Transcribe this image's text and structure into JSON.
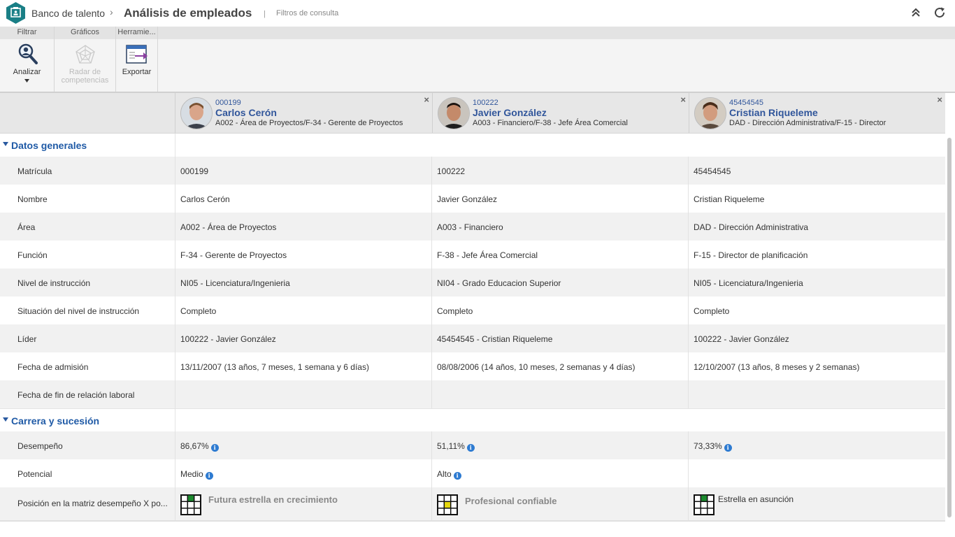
{
  "header": {
    "breadcrumb_root": "Banco de talento",
    "breadcrumb_sep": "›",
    "title": "Análisis de empleados",
    "title_sep": "|",
    "filters_link": "Filtros de consulta",
    "collapse_icon": "double-chevron-up-icon",
    "refresh_icon": "refresh-icon"
  },
  "ribbon": {
    "tabs": [
      "Filtrar",
      "Gráficos",
      "Herramie..."
    ],
    "buttons": {
      "analyze": "Analizar",
      "radar_line1": "Radar de",
      "radar_line2": "competencias",
      "export": "Exportar"
    }
  },
  "employees": [
    {
      "code": "000199",
      "name": "Carlos Cerón",
      "desc": "A002 - Área de Proyectos/F-34 - Gerente de Proyectos"
    },
    {
      "code": "100222",
      "name": "Javier González",
      "desc": "A003 - Financiero/F-38 - Jefe Área Comercial"
    },
    {
      "code": "45454545",
      "name": "Cristian Riqueleme",
      "desc": "DAD - Dirección Administrativa/F-15 - Director"
    }
  ],
  "close_glyph": "×",
  "sections": {
    "general": {
      "title": "Datos generales",
      "rows": [
        {
          "label": "Matrícula",
          "values": [
            "000199",
            "100222",
            "45454545"
          ]
        },
        {
          "label": "Nombre",
          "values": [
            "Carlos Cerón",
            "Javier González",
            "Cristian Riqueleme"
          ]
        },
        {
          "label": "Área",
          "values": [
            "A002 - Área de Proyectos",
            "A003 - Financiero",
            "DAD - Dirección Administrativa"
          ]
        },
        {
          "label": "Función",
          "values": [
            "F-34 - Gerente de Proyectos",
            "F-38 - Jefe Área Comercial",
            "F-15 - Director de planificación"
          ]
        },
        {
          "label": "Nivel de instrucción",
          "values": [
            "NI05 - Licenciatura/Ingenieria",
            "NI04 - Grado Educacion Superior",
            "NI05 - Licenciatura/Ingenieria"
          ]
        },
        {
          "label": "Situación del nivel de instrucción",
          "values": [
            "Completo",
            "Completo",
            "Completo"
          ]
        },
        {
          "label": "Líder",
          "values": [
            "100222 - Javier González",
            "45454545 - Cristian Riqueleme",
            "100222 - Javier González"
          ]
        },
        {
          "label": "Fecha de admisión",
          "values": [
            "13/11/2007 (13 años, 7 meses, 1 semana y 6 días)",
            "08/08/2006 (14 años, 10 meses, 2 semanas y 4 días)",
            "12/10/2007 (13 años, 8 meses y 2 semanas)"
          ]
        },
        {
          "label": "Fecha de fin de relación laboral",
          "values": [
            "",
            "",
            ""
          ]
        }
      ]
    },
    "career": {
      "title": "Carrera y sucesión",
      "performance_label": "Desempeño",
      "performance": [
        "86,67%",
        "51,11%",
        "73,33%"
      ],
      "potential_label": "Potencial",
      "potential": [
        "Medio",
        "Alto",
        ""
      ],
      "matrix_label": "Posición en la matriz desempeño X po...",
      "matrix": [
        {
          "text": "Futura estrella en crecimiento",
          "cell_color": "#1c8a2e"
        },
        {
          "text": "Profesional confiable",
          "cell_color": "#e6d80f"
        },
        {
          "text": "Estrella en asunción",
          "cell_color": "#1c8a2e"
        }
      ]
    }
  },
  "info_glyph": "i",
  "colors": {
    "accent": "#1f5aa6",
    "logo": "#1a7f86",
    "info": "#2e7bd1"
  }
}
